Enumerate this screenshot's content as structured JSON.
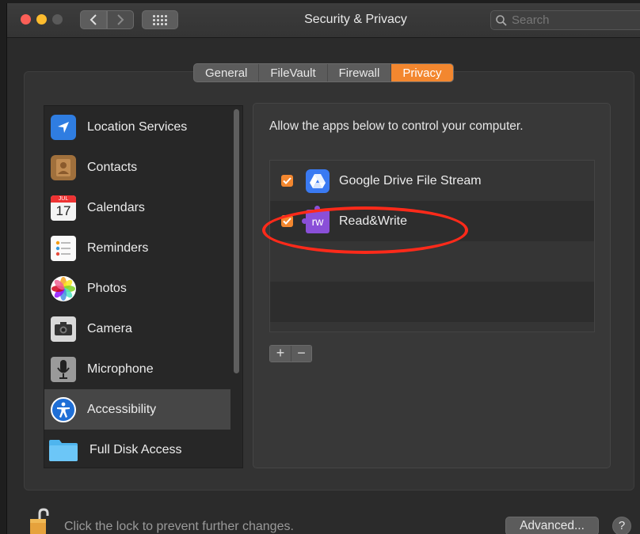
{
  "window": {
    "title": "Security & Privacy",
    "search_placeholder": "Search"
  },
  "tabs": [
    {
      "label": "General",
      "active": false
    },
    {
      "label": "FileVault",
      "active": false
    },
    {
      "label": "Firewall",
      "active": false
    },
    {
      "label": "Privacy",
      "active": true
    }
  ],
  "sidebar": {
    "items": [
      {
        "label": "Location Services",
        "icon": "location-arrow-icon"
      },
      {
        "label": "Contacts",
        "icon": "contacts-book-icon"
      },
      {
        "label": "Calendars",
        "icon": "calendar-icon",
        "icon_month": "JUL",
        "icon_day": "17"
      },
      {
        "label": "Reminders",
        "icon": "reminders-list-icon"
      },
      {
        "label": "Photos",
        "icon": "photos-flower-icon"
      },
      {
        "label": "Camera",
        "icon": "camera-icon"
      },
      {
        "label": "Microphone",
        "icon": "microphone-icon"
      },
      {
        "label": "Accessibility",
        "icon": "accessibility-icon",
        "selected": true
      },
      {
        "label": "Full Disk Access",
        "icon": "folder-icon"
      }
    ]
  },
  "panel": {
    "description": "Allow the apps below to control your computer.",
    "apps": [
      {
        "label": "Google Drive File Stream",
        "checked": true,
        "icon": "google-drive-icon"
      },
      {
        "label": "Read&Write",
        "checked": true,
        "icon": "readwrite-puzzle-icon",
        "icon_text": "rw"
      }
    ],
    "add_label": "+",
    "remove_label": "−"
  },
  "footer": {
    "lock_text": "Click the lock to prevent further changes.",
    "advanced_label": "Advanced...",
    "help_label": "?"
  },
  "colors": {
    "accent": "#f3872f",
    "highlight": "#ff2a1a",
    "close": "#fc5f57",
    "minimize": "#fdbc2e"
  }
}
